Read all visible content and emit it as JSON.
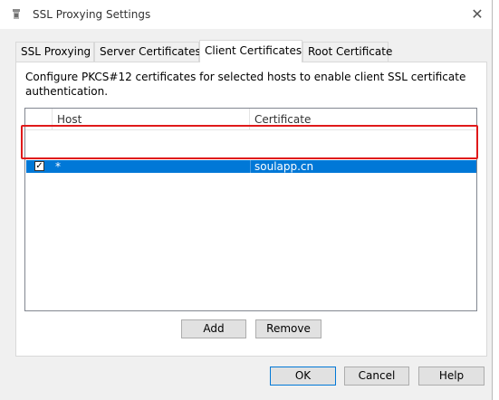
{
  "window": {
    "title": "SSL Proxying Settings"
  },
  "tabs": [
    {
      "label": "SSL Proxying",
      "active": false
    },
    {
      "label": "Server Certificates",
      "active": false
    },
    {
      "label": "Client Certificates",
      "active": true
    },
    {
      "label": "Root Certificate",
      "active": false
    }
  ],
  "panel": {
    "description": "Configure PKCS#12 certificates for selected hosts to enable client SSL certificate authentication."
  },
  "table": {
    "columns": [
      "Host",
      "Certificate"
    ],
    "rows": [
      {
        "checked": true,
        "host": "*",
        "certificate": "soulapp.cn",
        "selected": true
      }
    ]
  },
  "panel_buttons": {
    "add": "Add",
    "remove": "Remove"
  },
  "dialog_buttons": {
    "ok": "OK",
    "cancel": "Cancel",
    "help": "Help"
  },
  "colors": {
    "selection": "#0078d7",
    "annotation_outline": "#e0191a"
  },
  "icons": {
    "app": "charles-app-icon",
    "close": "close-icon",
    "checkbox": "checkbox-checked-icon"
  }
}
